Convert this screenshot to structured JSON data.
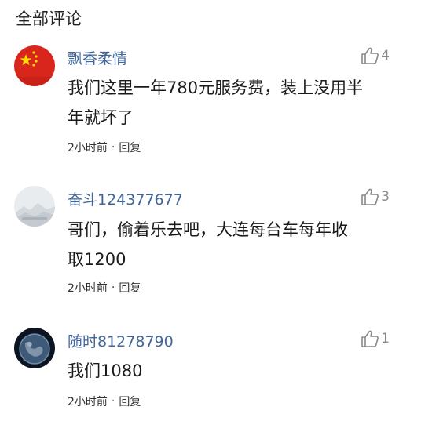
{
  "section": {
    "title": "全部评论"
  },
  "comments": [
    {
      "username": "飘香柔情",
      "likes": "4",
      "text_lines": [
        "我们这里一年780元服务费，装上没用半",
        "年就坏了"
      ],
      "time": "2小时前",
      "dot": "·",
      "reply_label": "回复",
      "avatar_icon": "china-flag-avatar"
    },
    {
      "username": "奋斗124377677",
      "likes": "3",
      "text_lines": [
        "哥们，偷着乐去吧，大连每台车每年收",
        "取1200"
      ],
      "time": "2小时前",
      "dot": "·",
      "reply_label": "回复",
      "avatar_icon": "mountain-avatar"
    },
    {
      "username": "随时81278790",
      "likes": "1",
      "text_lines": [
        "我们1080"
      ],
      "time": "2小时前",
      "dot": "·",
      "reply_label": "回复",
      "avatar_icon": "earth-avatar"
    }
  ],
  "colors": {
    "username": "#406599",
    "muted": "#888888",
    "text": "#1a1a1a"
  }
}
